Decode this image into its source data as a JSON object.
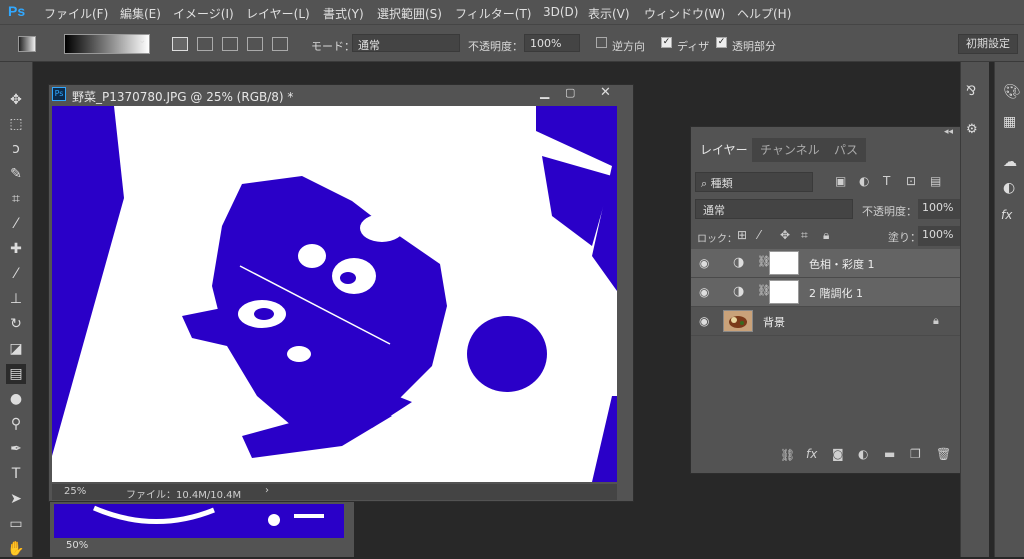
{
  "app": {
    "logo": "Ps"
  },
  "menu": [
    "ファイル(F)",
    "編集(E)",
    "イメージ(I)",
    "レイヤー(L)",
    "書式(Y)",
    "選択範囲(S)",
    "フィルター(T)",
    "3D(D)",
    "表示(V)",
    "ウィンドウ(W)",
    "ヘルプ(H)"
  ],
  "options": {
    "mode_label": "モード：",
    "mode_value": "通常",
    "opacity_label": "不透明度：",
    "opacity_value": "100%",
    "reverse_label": "逆方向",
    "dither_label": "ディザ",
    "transparency_label": "透明部分",
    "workspace_label": "初期設定",
    "gradient_colors": [
      "#000000",
      "#ffffff"
    ]
  },
  "document": {
    "title": "野菜_P1370780.JPG @ 25% (RGB/8) *",
    "zoom": "25%",
    "file_info": "ファイル：10.4M/10.4M",
    "back_zoom": "50%",
    "fill_color": "#2a00c8"
  },
  "layers_panel": {
    "tabs": [
      "レイヤー",
      "チャンネル",
      "パス"
    ],
    "filter_label": "種類",
    "blend_mode": "通常",
    "opacity_label": "不透明度：",
    "opacity_value": "100%",
    "lock_label": "ロック：",
    "fill_label": "塗り：",
    "fill_value": "100%",
    "layers": [
      {
        "name": "色相・彩度 1"
      },
      {
        "name": "2 階調化 1"
      },
      {
        "name": "背景"
      }
    ]
  }
}
